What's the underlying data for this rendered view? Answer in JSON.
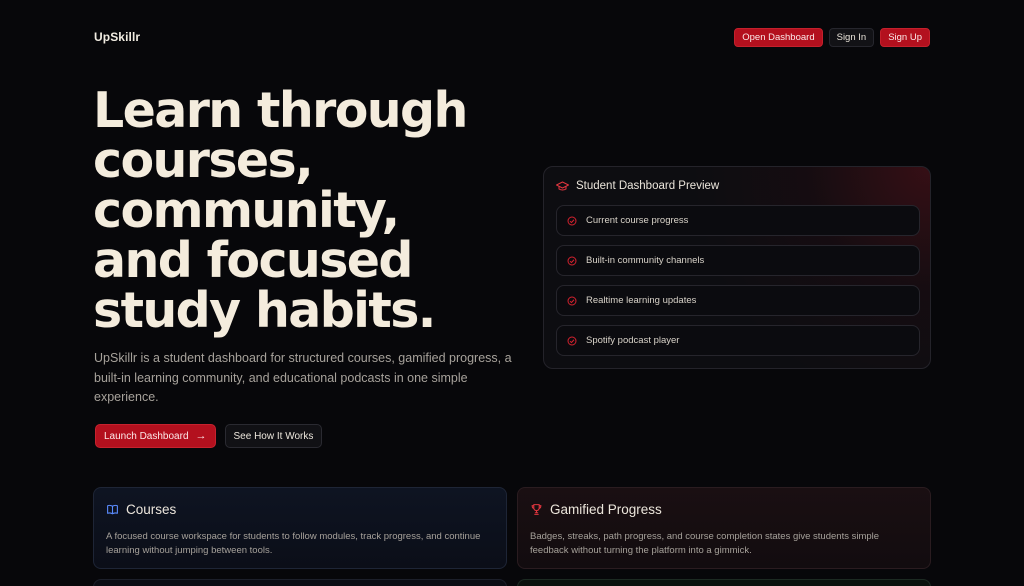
{
  "brand": "UpSkillr",
  "nav": {
    "open_dashboard": "Open Dashboard",
    "sign_in": "Sign In",
    "sign_up": "Sign Up"
  },
  "hero": {
    "title_lines": [
      "Learn through",
      "courses,",
      "community,",
      "and focused",
      "study habits."
    ],
    "description": "UpSkillr is a student dashboard for structured courses, gamified progress, a built-in learning community, and educational podcasts in one simple experience.",
    "primary_cta": "Launch Dashboard",
    "secondary_cta": "See How It Works"
  },
  "preview": {
    "title": "Student Dashboard Preview",
    "items": [
      "Current course progress",
      "Built-in community channels",
      "Realtime learning updates",
      "Spotify podcast player"
    ]
  },
  "features": [
    {
      "title": "Courses",
      "icon": "book-icon",
      "body": "A focused course workspace for students to follow modules, track progress, and continue learning without jumping between tools."
    },
    {
      "title": "Gamified Progress",
      "icon": "trophy-icon",
      "body": "Badges, streaks, path progress, and course completion states give students simple feedback without turning the platform into a gimmick."
    }
  ],
  "colors": {
    "accent": "#b3101e",
    "background": "#07070a",
    "heading": "#f4ecdd"
  }
}
